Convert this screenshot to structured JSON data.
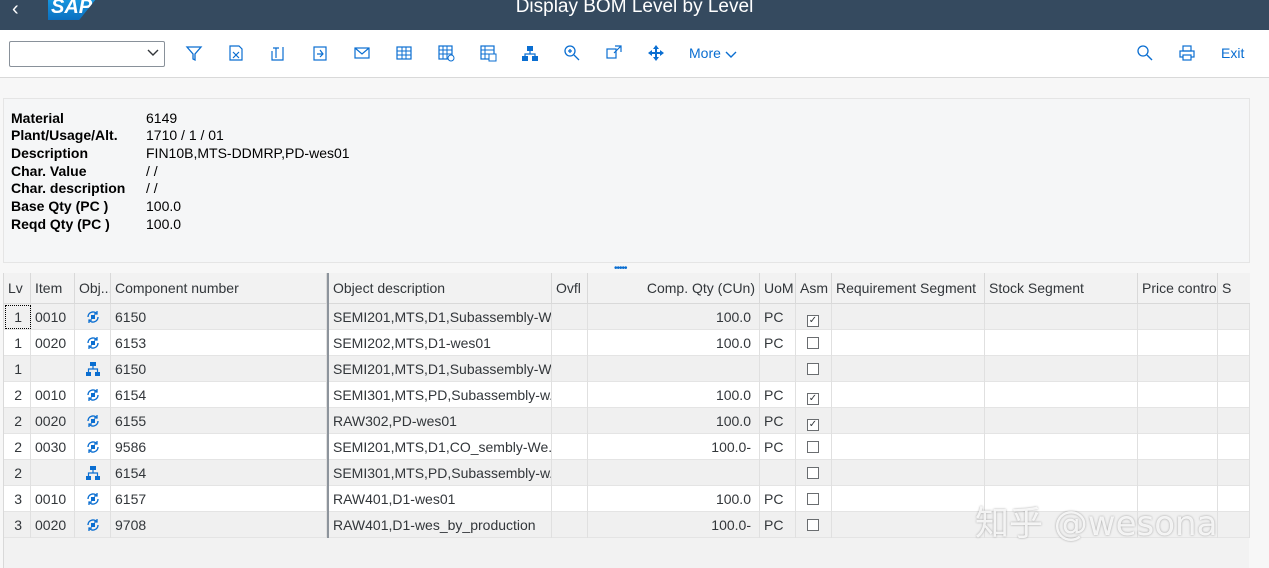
{
  "window": {
    "title": "Display BOM Level by Level",
    "logo": "SAP"
  },
  "toolbar": {
    "combo_value": "",
    "more_label": "More",
    "exit_label": "Exit",
    "icons": [
      "filter-icon",
      "formula-icon",
      "export-icon",
      "upload-icon",
      "mail-icon",
      "grid-icon",
      "grid-settings-icon",
      "grid-icon-2",
      "hierarchy-icon",
      "zoom-icon",
      "expand-icon",
      "move-icon"
    ]
  },
  "header": {
    "fields": [
      {
        "label": "Material",
        "value": "6149"
      },
      {
        "label": "Plant/Usage/Alt.",
        "value": "1710 / 1 / 01"
      },
      {
        "label": "Description",
        "value": "FIN10B,MTS-DDMRP,PD-wes01"
      },
      {
        "label": "Char. Value",
        "value": "/ /"
      },
      {
        "label": "Char. description",
        "value": "/ /"
      },
      {
        "label": "Base Qty (PC )",
        "value": "100.0"
      },
      {
        "label": "Reqd Qty (PC )",
        "value": "100.0"
      }
    ]
  },
  "table": {
    "columns": [
      "Lv",
      "Item",
      "Obj...",
      "Component number",
      "Object description",
      "Ovfl",
      "Comp. Qty (CUn)",
      "UoM",
      "Asm",
      "Requirement Segment",
      "Stock Segment",
      "Price control",
      "S"
    ],
    "rows": [
      {
        "lv": "1",
        "item": "0010",
        "obj": "material",
        "comp": "6150",
        "desc": "SEMI201,MTS,D1,Subassembly-W...",
        "qty": "100.0",
        "uom": "PC",
        "asm": true
      },
      {
        "lv": "1",
        "item": "0020",
        "obj": "material",
        "comp": "6153",
        "desc": "SEMI202,MTS,D1-wes01",
        "qty": "100.0",
        "uom": "PC",
        "asm": false
      },
      {
        "lv": "1",
        "item": "",
        "obj": "bom",
        "comp": "6150",
        "desc": "SEMI201,MTS,D1,Subassembly-W...",
        "qty": "",
        "uom": "",
        "asm": false
      },
      {
        "lv": "2",
        "item": "0010",
        "obj": "material",
        "comp": "6154",
        "desc": "SEMI301,MTS,PD,Subassembly-w...",
        "qty": "100.0",
        "uom": "PC",
        "asm": true
      },
      {
        "lv": "2",
        "item": "0020",
        "obj": "material",
        "comp": "6155",
        "desc": "RAW302,PD-wes01",
        "qty": "100.0",
        "uom": "PC",
        "asm": true
      },
      {
        "lv": "2",
        "item": "0030",
        "obj": "material",
        "comp": "9586",
        "desc": "SEMI201,MTS,D1,CO_sembly-We...",
        "qty": "100.0-",
        "uom": "PC",
        "asm": false
      },
      {
        "lv": "2",
        "item": "",
        "obj": "bom",
        "comp": "6154",
        "desc": "SEMI301,MTS,PD,Subassembly-w...",
        "qty": "",
        "uom": "",
        "asm": false
      },
      {
        "lv": "3",
        "item": "0010",
        "obj": "material",
        "comp": "6157",
        "desc": "RAW401,D1-wes01",
        "qty": "100.0",
        "uom": "PC",
        "asm": false
      },
      {
        "lv": "3",
        "item": "0020",
        "obj": "material",
        "comp": "9708",
        "desc": "RAW401,D1-wes_by_production",
        "qty": "100.0-",
        "uom": "PC",
        "asm": false
      }
    ]
  },
  "watermark": "知乎 @wesona",
  "colors": {
    "shell": "#354a5f",
    "accent": "#0a6ed1"
  }
}
